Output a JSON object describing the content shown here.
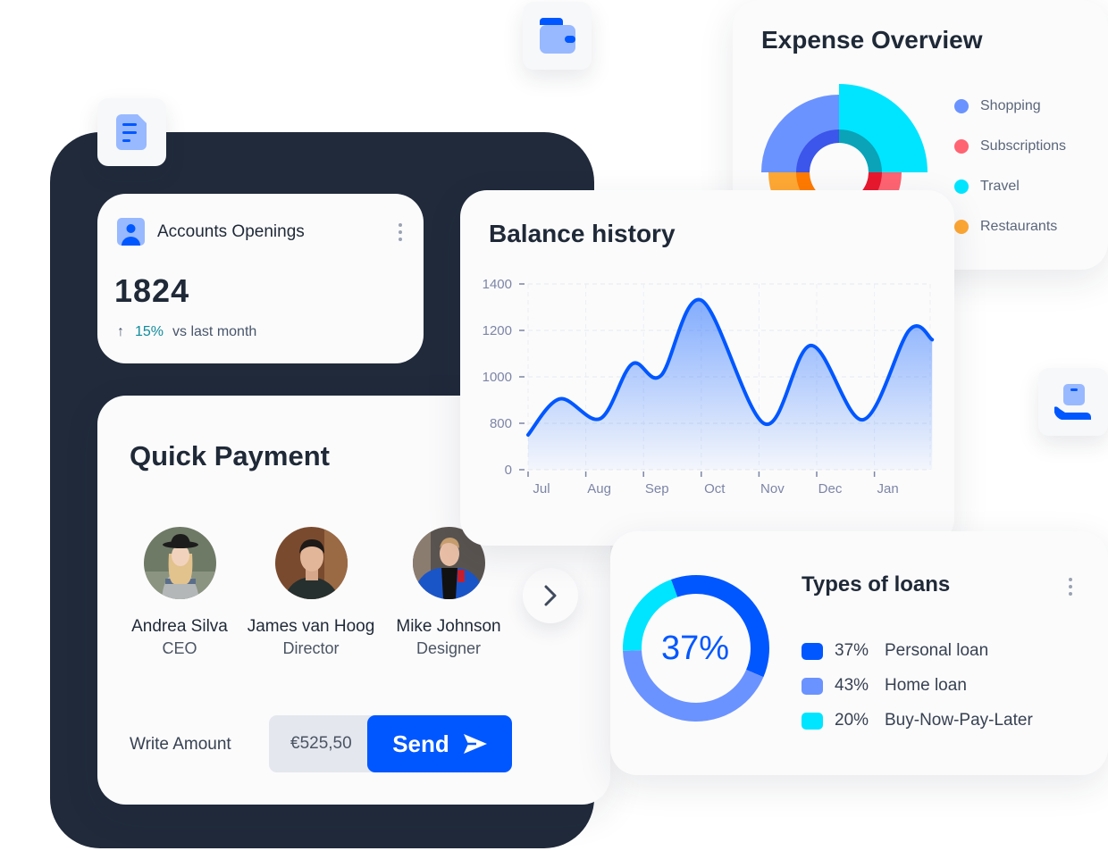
{
  "floating_icons": [
    {
      "name": "document-icon"
    },
    {
      "name": "wallet-icon"
    },
    {
      "name": "hand-box-icon"
    }
  ],
  "accounts": {
    "title": "Accounts Openings",
    "value": "1824",
    "change_arrow": "↑",
    "change_pct": "15%",
    "change_label": "vs last month",
    "icon": "user-icon"
  },
  "quick_payment": {
    "title": "Quick Payment",
    "contacts": [
      {
        "name": "Andrea Silva",
        "role": "CEO"
      },
      {
        "name": "James van Hoog",
        "role": "Director"
      },
      {
        "name": "Mike Johnson",
        "role": "Designer"
      }
    ],
    "next_icon": "chevron-right-icon",
    "amount_label": "Write Amount",
    "amount_value": "€525,50",
    "send_label": "Send",
    "send_icon": "paper-plane-icon"
  },
  "expense": {
    "title": "Expense Overview",
    "legend": [
      {
        "label": "Shopping",
        "color": "#6b93ff"
      },
      {
        "label": "Subscriptions",
        "color": "#ff6472"
      },
      {
        "label": "Travel",
        "color": "#00e5ff"
      },
      {
        "label": "Restaurants",
        "color": "#ffa834"
      }
    ]
  },
  "loans": {
    "title": "Types of loans",
    "center_label": "37%",
    "items": [
      {
        "pct": "37%",
        "label": "Personal loan",
        "value": 37,
        "color": "#0057ff"
      },
      {
        "pct": "43%",
        "label": "Home loan",
        "value": 43,
        "color": "#6b93ff"
      },
      {
        "pct": "20%",
        "label": "Buy-Now-Pay-Later",
        "value": 20,
        "color": "#00e5ff"
      }
    ]
  },
  "colors": {
    "accent": "#0057ff",
    "dark_panel": "#202a3b",
    "positive": "#0f8b9a"
  },
  "chart_data": [
    {
      "type": "area",
      "title": "Balance history",
      "categories": [
        "Jul",
        "Aug",
        "Sep",
        "Oct",
        "Nov",
        "Dec",
        "Jan"
      ],
      "yticks": [
        "0",
        "800",
        "1000",
        "1200",
        "1400"
      ],
      "ylim": [
        0,
        1400
      ],
      "grid": true,
      "series": [
        {
          "name": "Balance",
          "color": "#0057ff",
          "points": [
            {
              "x": 0.0,
              "y": 600
            },
            {
              "x": 0.55,
              "y": 905
            },
            {
              "x": 1.25,
              "y": 820
            },
            {
              "x": 1.8,
              "y": 1055
            },
            {
              "x": 2.3,
              "y": 1005
            },
            {
              "x": 3.0,
              "y": 1330
            },
            {
              "x": 4.1,
              "y": 790
            },
            {
              "x": 4.9,
              "y": 1135
            },
            {
              "x": 5.8,
              "y": 815
            },
            {
              "x": 6.6,
              "y": 1200
            },
            {
              "x": 7.0,
              "y": 1160
            }
          ]
        }
      ]
    },
    {
      "type": "pie",
      "subtype": "polar-area",
      "title": "Expense Overview",
      "categories": [
        "Shopping",
        "Travel",
        "Subscriptions",
        "Restaurants"
      ],
      "values": [
        87,
        99,
        70,
        79
      ],
      "note": "relative magnitudes estimated from segment radii"
    },
    {
      "type": "pie",
      "subtype": "donut",
      "title": "Types of loans",
      "categories": [
        "Personal loan",
        "Home loan",
        "Buy-Now-Pay-Later"
      ],
      "values": [
        37,
        43,
        20
      ]
    }
  ]
}
